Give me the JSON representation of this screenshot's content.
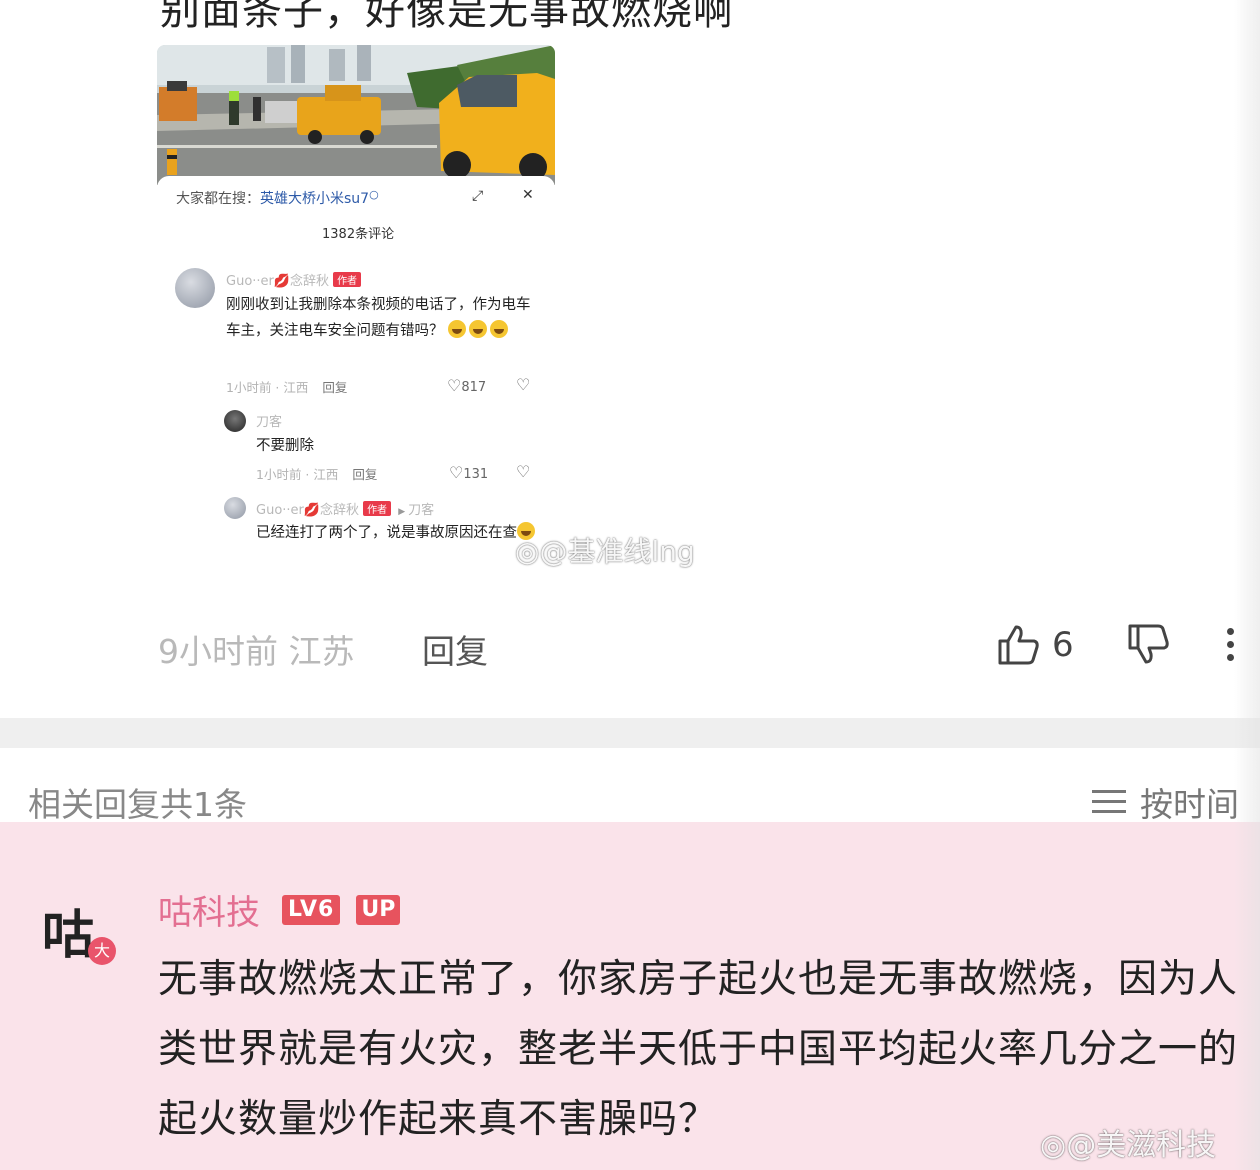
{
  "top_comment": {
    "cut_text": "别面条子，好像是无事故燃烧啊",
    "embedded_screenshot": {
      "search_label": "大家都在搜：",
      "search_keyword": "英雄大桥小米su7",
      "comment_count": "1382条评论",
      "comments": [
        {
          "user": "Guo··er💋念辞秋",
          "tag": "作者",
          "text": "刚刚收到让我删除本条视频的电话了，作为电车车主，关注电车安全问题有错吗？",
          "meta": "1小时前 · 江西",
          "reply": "回复",
          "likes": "817"
        },
        {
          "user": "刀客",
          "text": "不要删除",
          "meta": "1小时前 · 江西",
          "reply": "回复",
          "likes": "131"
        },
        {
          "user": "Guo··er💋念辞秋",
          "tag": "作者",
          "reply_to": "刀客",
          "text": "已经连打了两个了，说是事故原因还在查"
        }
      ],
      "watermark": "@基准线lng"
    },
    "meta_time_loc": "9小时前 江苏",
    "reply_label": "回复",
    "likes": "6"
  },
  "related": {
    "count_label": "相关回复共1条",
    "sort_label": "按时间"
  },
  "reply": {
    "author": "咕科技",
    "level": "LV6",
    "badge": "UP",
    "avatar_char": "咕",
    "avatar_badge": "大",
    "text": "无事故燃烧太正常了，你家房子起火也是无事故燃烧，因为人类世界就是有火灾，整老半天低于中国平均起火率几分之一的起火数量炒作起来真不害臊吗？"
  },
  "watermark": "@美滋科技"
}
